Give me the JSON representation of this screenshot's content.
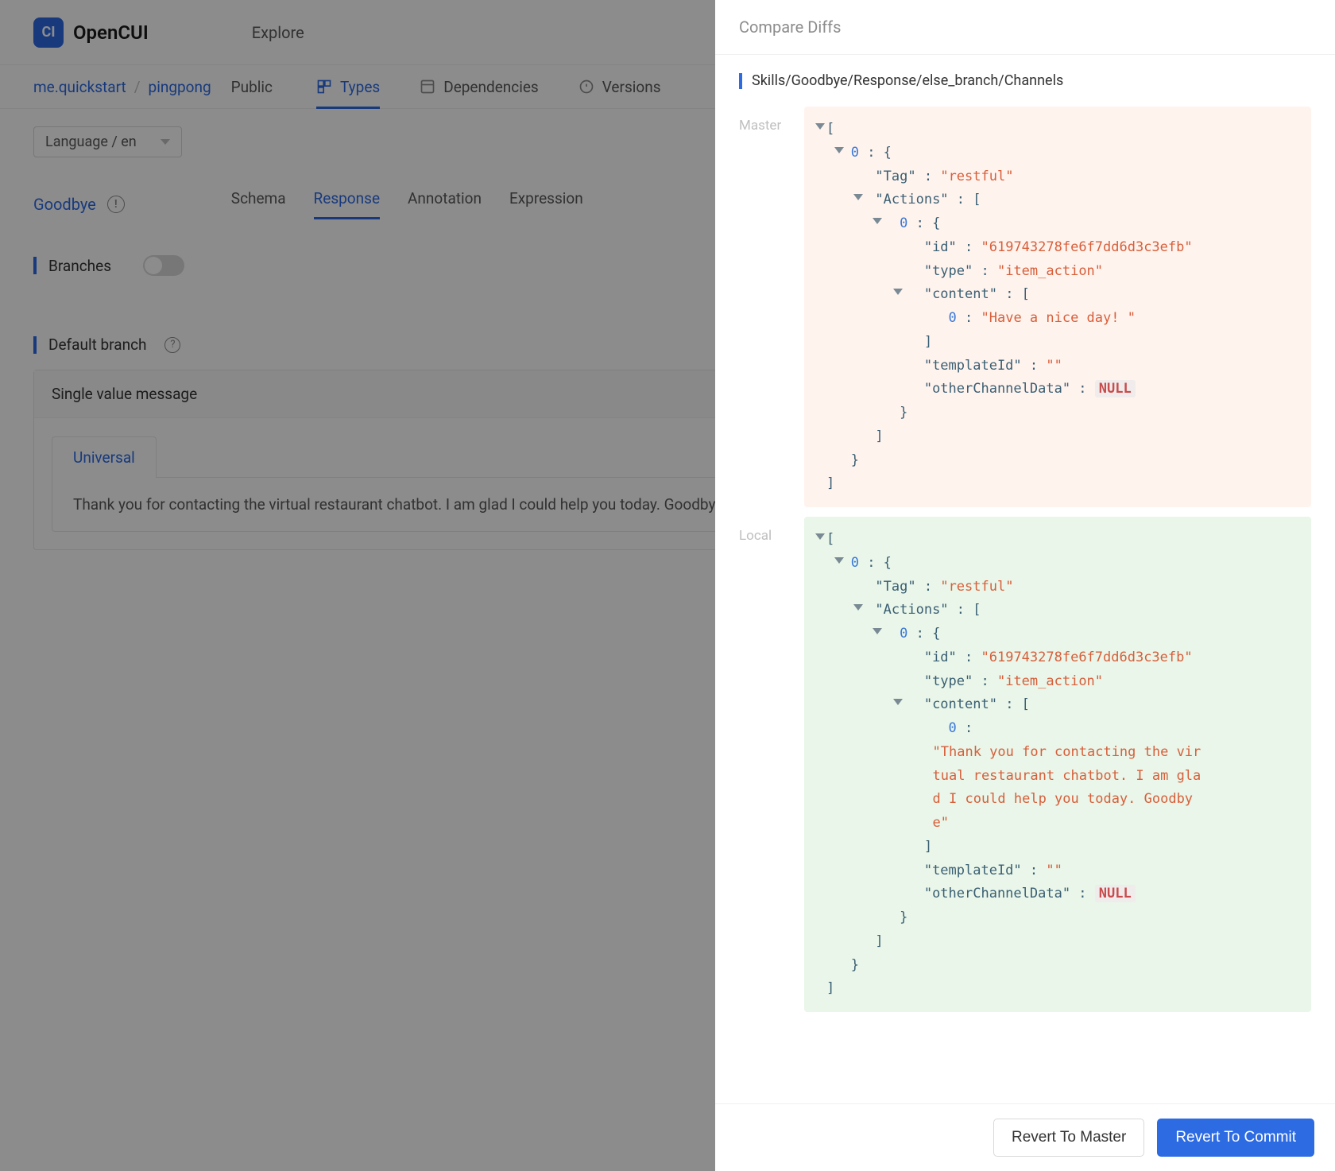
{
  "header": {
    "logo_text": "CI",
    "brand": "OpenCUI",
    "explore": "Explore"
  },
  "breadcrumb": {
    "org": "me.quickstart",
    "project": "pingpong",
    "visibility": "Public"
  },
  "navTabs": {
    "types": "Types",
    "dependencies": "Dependencies",
    "versions": "Versions"
  },
  "language_selector": "Language / en",
  "skill": {
    "name": "Goodbye"
  },
  "subTabs": {
    "schema": "Schema",
    "response": "Response",
    "annotation": "Annotation",
    "expression": "Expression"
  },
  "sections": {
    "branches": "Branches",
    "default_branch": "Default branch"
  },
  "card": {
    "title": "Single value message",
    "universal_tab": "Universal",
    "message": "Thank you for contacting the virtual restaurant chatbot. I am glad I could help you today. Goodbye"
  },
  "drawer": {
    "title": "Compare Diffs",
    "path": "Skills/Goodbye/Response/else_branch/Channels",
    "master_label": "Master",
    "local_label": "Local",
    "revert_master": "Revert To Master",
    "revert_commit": "Revert To Commit"
  },
  "diff": {
    "tag_key": "\"Tag\"",
    "tag_val": "\"restful\"",
    "actions_key": "\"Actions\"",
    "id_key": "\"id\"",
    "id_val": "\"619743278fe6f7dd6d3c3efb\"",
    "type_key": "\"type\"",
    "type_val": "\"item_action\"",
    "content_key": "\"content\"",
    "master_content_val": "\"Have a nice day! \"",
    "local_content_val": "\"Thank you for contacting the virtual restaurant chatbot. I am glad I could help you today. Goodbye\"",
    "templateId_key": "\"templateId\"",
    "templateId_val": "\"\"",
    "other_key": "\"otherChannelData\"",
    "null_label": "NULL",
    "zero": "0",
    "colon_brace": " : {",
    "colon_bracket": " : [",
    "colon_sp": " : ",
    "open_bracket": "[",
    "close_bracket": "]",
    "open_brace": "{",
    "close_brace": "}"
  }
}
